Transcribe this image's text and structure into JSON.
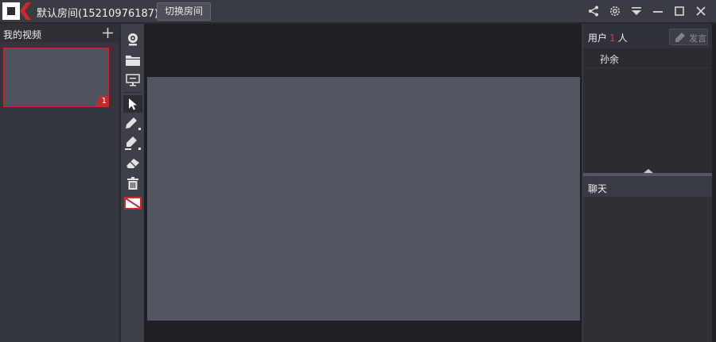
{
  "titlebar": {
    "title": "默认房间(15210976187)",
    "switch_room_label": "切换房间",
    "icons": [
      "share-icon",
      "settings-icon",
      "dropdown-icon",
      "minimize-icon",
      "maximize-icon",
      "close-icon"
    ]
  },
  "videos": {
    "title": "我的视频",
    "add_icon": "plus-icon",
    "thumbnail": {
      "badge": "1"
    }
  },
  "toolbar": {
    "tools": [
      "camera-icon",
      "folder-icon",
      "screen-share-icon",
      "pointer-icon",
      "pen-icon",
      "highlighter-icon",
      "eraser-icon",
      "trash-icon",
      "color-swatch-icon"
    ]
  },
  "users": {
    "label_prefix": "用户",
    "count": "1",
    "label_suffix": "人",
    "speak_label": "发言",
    "list": [
      {
        "name": "孙余"
      }
    ]
  },
  "chat": {
    "label": "聊天"
  },
  "colors": {
    "accent_red": "#c5282d",
    "panel_bg": "#34363d",
    "canvas_bg": "#525660",
    "stage_bg": "#1f2024"
  }
}
